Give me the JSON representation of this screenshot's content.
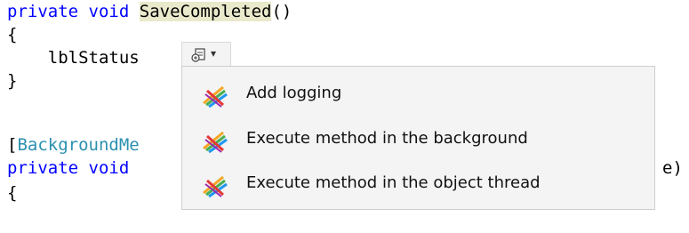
{
  "code": {
    "l1": {
      "kw1": "private",
      "kw2": "void",
      "method": "SaveCompleted",
      "rest": "()"
    },
    "l2": "{",
    "l3": {
      "text": "    lblStatus",
      "hidden_tail": "\"              \";"
    },
    "l4": "}",
    "l6": {
      "open": "[",
      "attr": "BackgroundMe"
    },
    "l7": {
      "kw1": "private",
      "kw2": "void",
      "tail": "e)"
    },
    "l8": "{"
  },
  "smart_tag": {
    "icon": "refactor-lightbulb-icon",
    "chevron": "▾"
  },
  "menu": {
    "items": [
      {
        "label": "Add logging",
        "icon": "postsharp-icon"
      },
      {
        "label": "Execute method in the background",
        "icon": "postsharp-icon"
      },
      {
        "label": "Execute method in the object thread",
        "icon": "postsharp-icon"
      }
    ]
  },
  "colors": {
    "keyword": "#0000ff",
    "type": "#2b91af",
    "highlight": "#e9e9cc",
    "menu_bg": "#f4f4f4"
  }
}
